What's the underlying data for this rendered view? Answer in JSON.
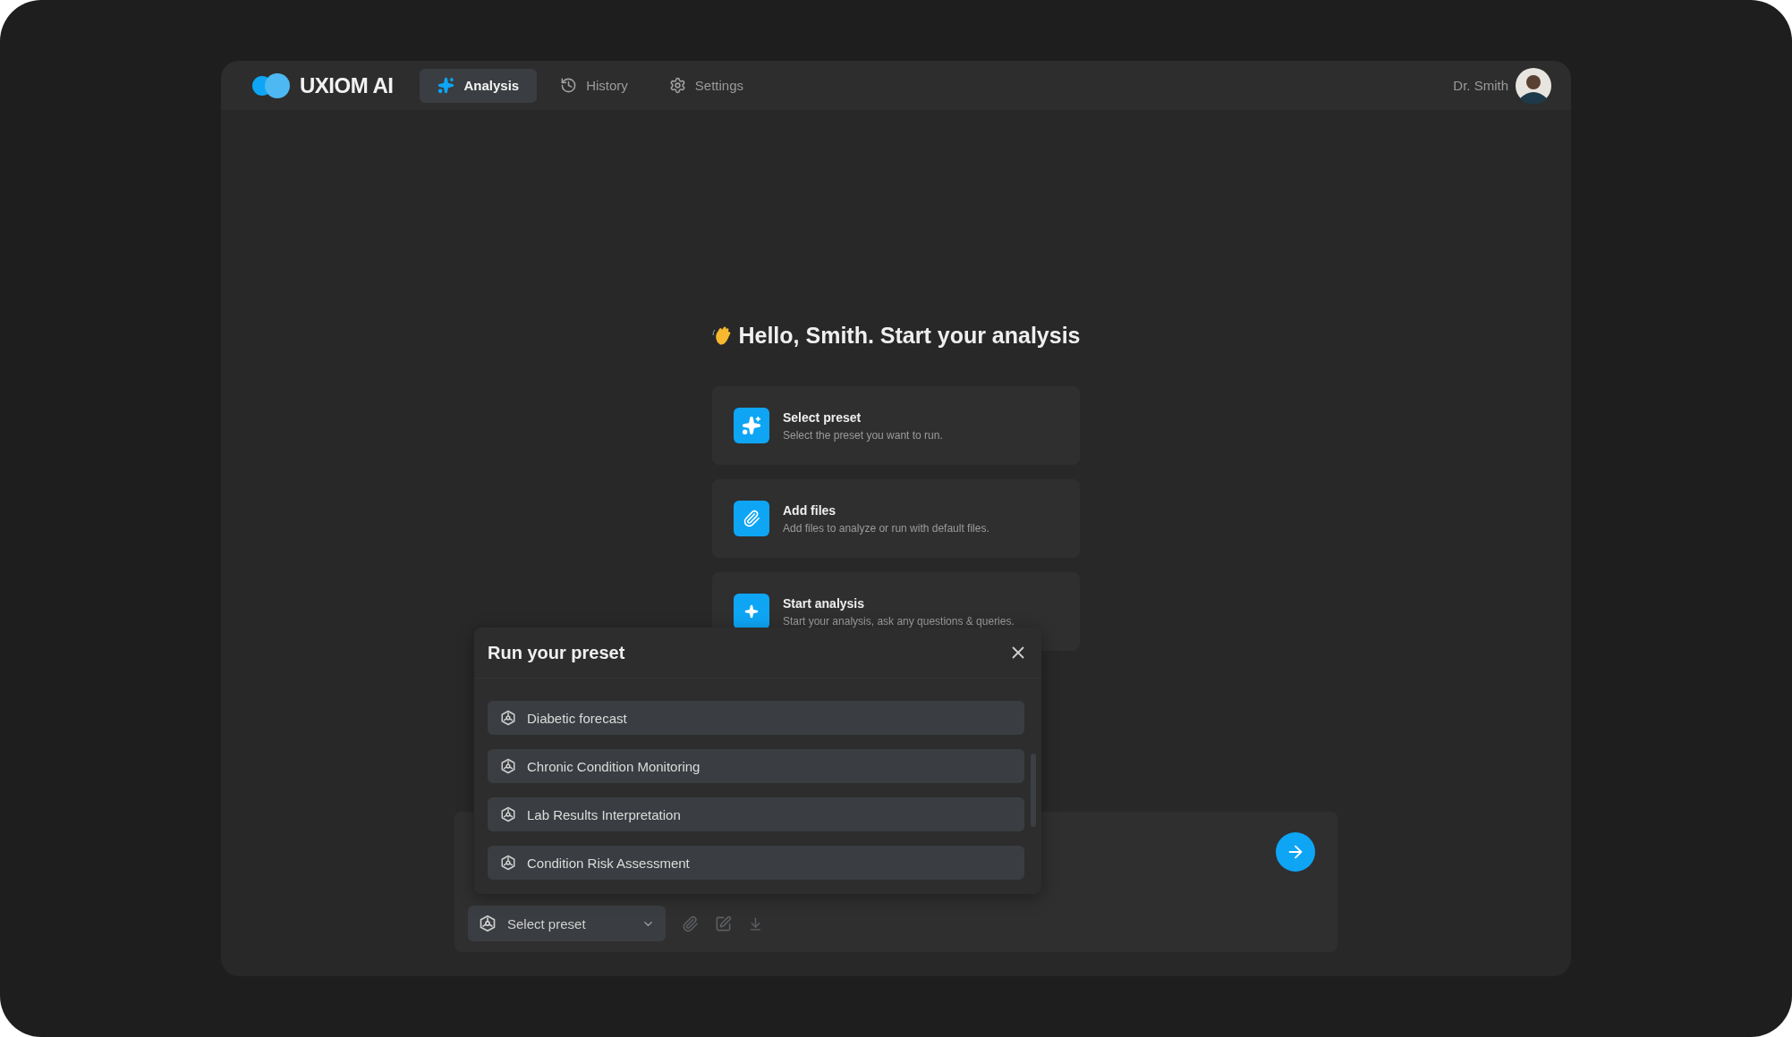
{
  "app": {
    "logo": "UXIOM AI"
  },
  "nav": [
    {
      "label": "Analysis",
      "selected": true
    },
    {
      "label": "History",
      "selected": false
    },
    {
      "label": "Settings",
      "selected": false
    }
  ],
  "user": {
    "name": "Dr. Smith"
  },
  "greeting": "Hello, Smith. Start your analysis",
  "steps": [
    {
      "title": "Select preset",
      "description": "Select the preset you want to run."
    },
    {
      "title": "Add files",
      "description": "Add files to analyze or run with default files."
    },
    {
      "title": "Start analysis",
      "description": "Start your analysis, ask any questions & queries."
    }
  ],
  "preset_dialog": {
    "title": "Run your preset",
    "presets": [
      "Diabetic forecast",
      "Chronic Condition Monitoring",
      "Lab Results Interpretation",
      "Condition Risk Assessment"
    ]
  },
  "composer": {
    "preset_select": "Select preset"
  }
}
